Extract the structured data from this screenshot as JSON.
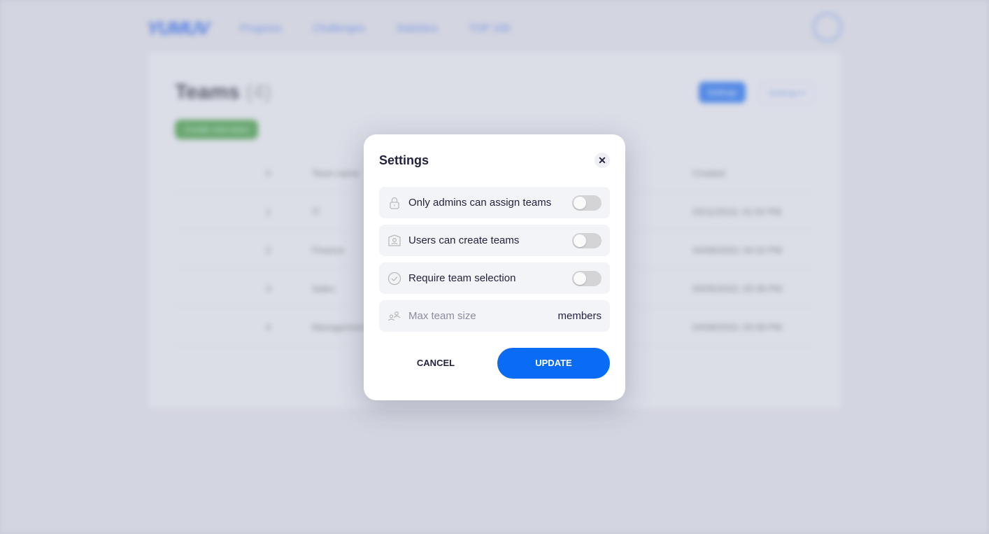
{
  "nav": {
    "logo": "YUMUV",
    "links": [
      "Progress",
      "Challenges",
      "Statistics",
      "TOP 100"
    ]
  },
  "page": {
    "title": "Teams",
    "count": "(4)",
    "create_label": "Create new team",
    "settings_label": "Settings",
    "settings2_label": "Settings ▾",
    "columns": [
      "#",
      "Team name",
      "Created"
    ],
    "rows": [
      {
        "n": "1",
        "name": "IT",
        "created": "03/11/2016, 01:02 PM"
      },
      {
        "n": "2",
        "name": "Finance",
        "created": "04/08/2020, 04:32 PM"
      },
      {
        "n": "3",
        "name": "Sales",
        "created": "05/05/2020, 05:38 PM"
      },
      {
        "n": "4",
        "name": "Management",
        "created": "04/08/2020, 05:58 PM"
      }
    ]
  },
  "modal": {
    "title": "Settings",
    "options": [
      {
        "label": "Only admins can assign teams",
        "icon": "lock-icon",
        "on": false
      },
      {
        "label": "Users can create teams",
        "icon": "user-badge-icon",
        "on": false
      },
      {
        "label": "Require team selection",
        "icon": "check-circle-icon",
        "on": false
      }
    ],
    "max_team_size": {
      "placeholder": "Max team size",
      "value": "",
      "unit": "members"
    },
    "cancel_label": "CANCEL",
    "update_label": "UPDATE"
  },
  "colors": {
    "accent": "#0a6cf5",
    "create": "#3c9a3c"
  }
}
